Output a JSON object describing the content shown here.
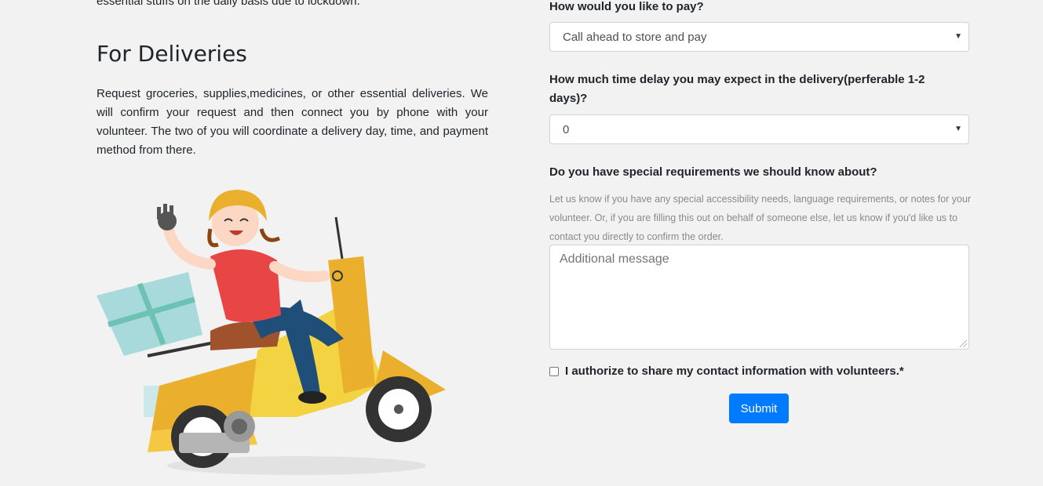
{
  "left": {
    "cut_text": "essential stuffs on the daily basis due to lockdown.",
    "heading": "For Deliveries",
    "paragraph": "Request groceries, supplies,medicines, or other essential deliveries. We will confirm your request and then connect you by phone with your volunteer. The two of you will coordinate a delivery day, time, and payment method from there.",
    "illustration": "delivery-scooter-illustration"
  },
  "form": {
    "pay_label": "How would you like to pay?",
    "pay_value": "Call ahead to store and pay",
    "delay_label": "How much time delay you may expect in the delivery(perferable 1-2 days)?",
    "delay_value": "0",
    "requirements_label": "Do you have special requirements we should know about?",
    "requirements_help": "Let us know if you have any special accessibility needs, language requirements, or notes for your volunteer. Or, if you are filling this out on behalf of someone else, let us know if you'd like us to contact you directly to confirm the order.",
    "message_placeholder": "Additional message",
    "authorize_label": "I authorize to share my contact information with volunteers.*",
    "submit_label": "Submit"
  },
  "colors": {
    "background": "#f2f2f2",
    "primary": "#007bff"
  }
}
